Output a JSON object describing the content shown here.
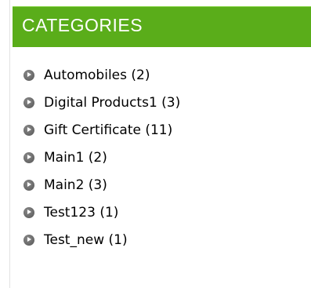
{
  "sidebar": {
    "title": "CATEGORIES",
    "items": [
      {
        "label": "Automobiles (2)"
      },
      {
        "label": "Digital Products1 (3)"
      },
      {
        "label": "Gift Certificate (11)"
      },
      {
        "label": "Main1 (2)"
      },
      {
        "label": "Main2 (3)"
      },
      {
        "label": "Test123 (1)"
      },
      {
        "label": "Test_new (1)"
      }
    ]
  },
  "colors": {
    "header_bg": "#5aad1a",
    "header_text": "#ffffff",
    "bullet": "#666666"
  },
  "icons": {
    "bullet": "circle-arrow-right-icon"
  }
}
